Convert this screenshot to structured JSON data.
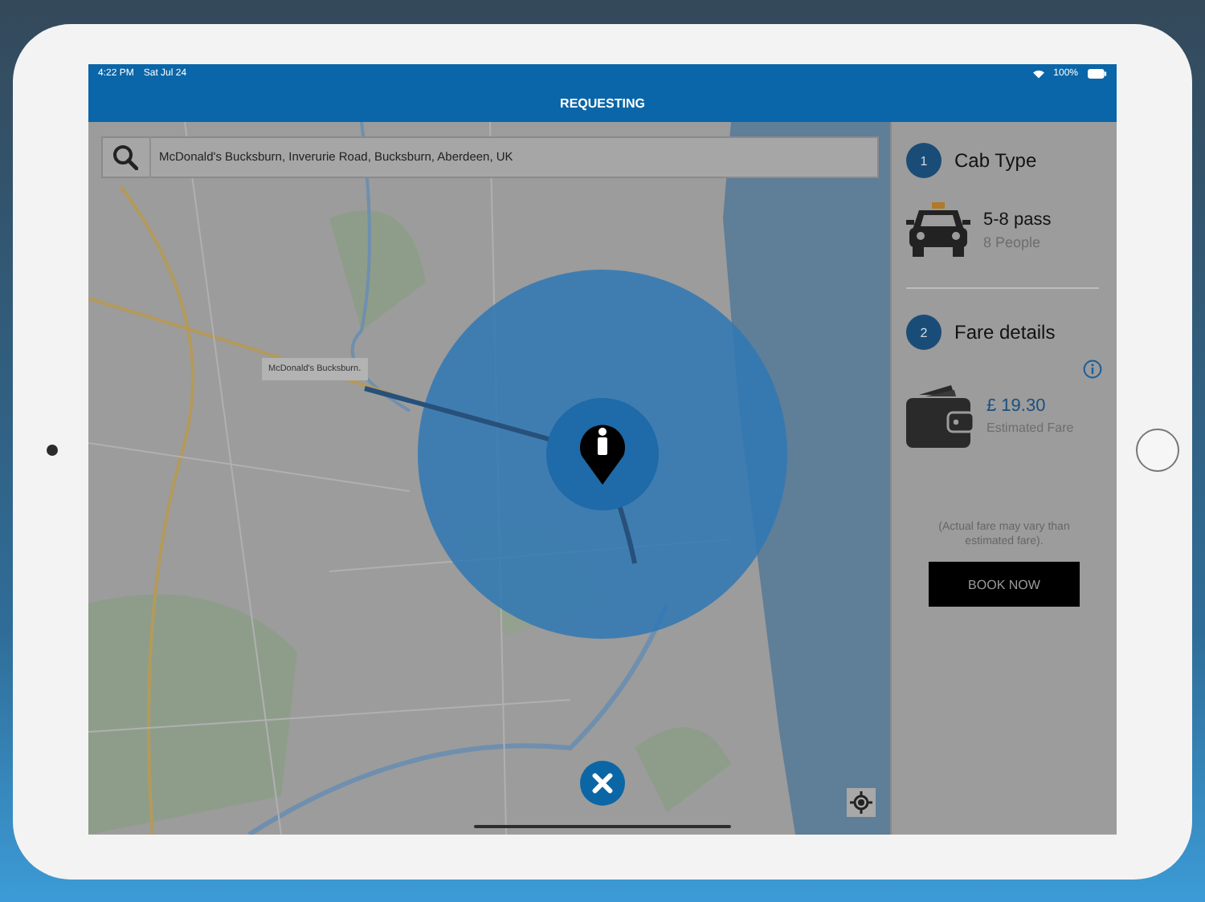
{
  "status_bar": {
    "time": "4:22 PM",
    "date": "Sat Jul 24",
    "battery": "100%"
  },
  "header": {
    "title": "REQUESTING"
  },
  "search": {
    "value": "McDonald's Bucksburn, Inverurie Road, Bucksburn, Aberdeen, UK"
  },
  "map": {
    "pickup_label": "McDonald's Bucksburn."
  },
  "steps": [
    {
      "number": "1",
      "title": "Cab Type"
    },
    {
      "number": "2",
      "title": "Fare details"
    }
  ],
  "cab": {
    "name": "5-8 pass",
    "capacity": "8 People"
  },
  "fare": {
    "amount": "£ 19.30",
    "label": "Estimated Fare"
  },
  "note": "(Actual fare may vary than estimated fare).",
  "book_button": "BOOK NOW"
}
